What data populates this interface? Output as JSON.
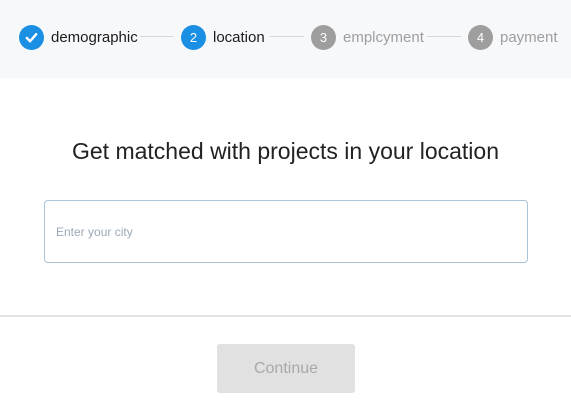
{
  "steps": [
    {
      "number": "",
      "label": "demographic",
      "state": "done",
      "icon": "check-icon"
    },
    {
      "number": "2",
      "label": "location",
      "state": "active"
    },
    {
      "number": "3",
      "label": "emplcyment",
      "state": "todo"
    },
    {
      "number": "4",
      "label": "payment",
      "state": "todo"
    }
  ],
  "main": {
    "heading": "Get matched with projects in your location",
    "city_placeholder": "Enter your city",
    "city_value": ""
  },
  "footer": {
    "continue_label": "Continue",
    "continue_disabled": true
  },
  "colors": {
    "accent": "#1a8fe3",
    "inactive": "#9e9e9e",
    "stepper_bg": "#f7f8fa",
    "button_disabled_bg": "#e1e1e1"
  }
}
